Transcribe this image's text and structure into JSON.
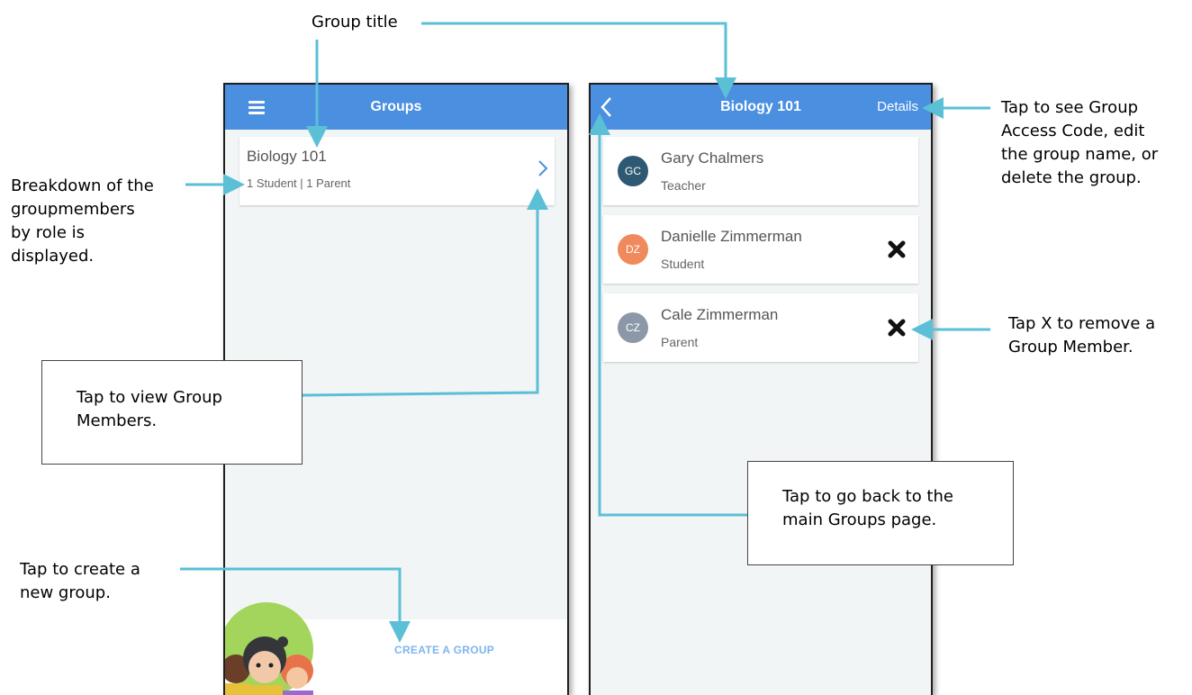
{
  "left_screen": {
    "title": "Groups",
    "group": {
      "name": "Biology 101",
      "breakdown": "1 Student | 1 Parent"
    },
    "create_label": "CREATE A GROUP"
  },
  "right_screen": {
    "title": "Biology 101",
    "details_label": "Details",
    "members": [
      {
        "initials": "GC",
        "name": "Gary Chalmers",
        "role": "Teacher",
        "color": "#2f5872",
        "removable": false
      },
      {
        "initials": "DZ",
        "name": "Danielle Zimmerman",
        "role": "Student",
        "color": "#f08a5d",
        "removable": true
      },
      {
        "initials": "CZ",
        "name": "Cale Zimmerman",
        "role": "Parent",
        "color": "#8c98a8",
        "removable": true
      }
    ]
  },
  "annotations": {
    "group_title": "Group title",
    "breakdown": [
      "Breakdown of the",
      "groupmembers",
      "by role is",
      "displayed."
    ],
    "view_members": [
      "Tap to view Group",
      "Members."
    ],
    "create_group": [
      "Tap to create a",
      "new group."
    ],
    "details": [
      "Tap to see Group",
      "Access Code, edit",
      "the group name, or",
      "delete the group."
    ],
    "remove": [
      "Tap X to remove a",
      "Group Member."
    ],
    "back": [
      "Tap to go back to the",
      "main Groups page."
    ]
  },
  "colors": {
    "app_bar": "#4a8fe0",
    "screen_bg": "#f1f5f5",
    "chevron": "#4a8fe0",
    "create_link": "#7cb6ee",
    "arrow": "#5bbfd6"
  },
  "icons": {
    "menu": "hamburger-icon",
    "back": "chevron-left-icon",
    "open": "chevron-right-icon",
    "remove": "close-x-icon"
  }
}
